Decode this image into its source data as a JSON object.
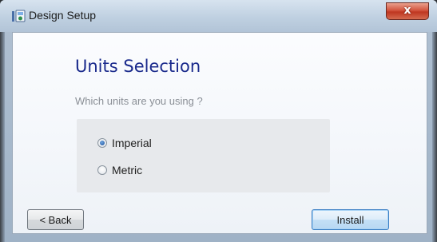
{
  "window": {
    "title": "Design Setup",
    "close_glyph": "x",
    "icon": "installer-app-icon"
  },
  "page": {
    "heading": "Units Selection",
    "subheading": "Which units are you using ?"
  },
  "units": {
    "selected": "Imperial",
    "options": [
      {
        "label": "Imperial",
        "checked": true
      },
      {
        "label": "Metric",
        "checked": false
      }
    ]
  },
  "buttons": {
    "back_label": "< Back",
    "install_label": "Install"
  },
  "colors": {
    "heading": "#1a2a8c",
    "subheading": "#8a8f96",
    "close_button": "#c9442d",
    "default_button_border": "#3b7fc4"
  }
}
